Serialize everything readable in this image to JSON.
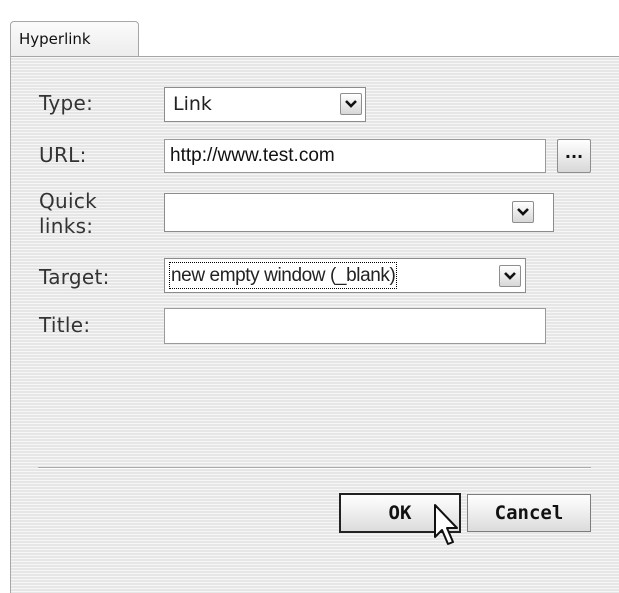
{
  "tab": {
    "label": "Hyperlink"
  },
  "fields": {
    "type": {
      "label": "Type:",
      "value": "Link"
    },
    "url": {
      "label": "URL:",
      "value": "http://www.test.com",
      "browse_label": "..."
    },
    "quick_links": {
      "label_line1": "Quick",
      "label_line2": "links:",
      "value": ""
    },
    "target": {
      "label": "Target:",
      "value": "new empty window (_blank)"
    },
    "title": {
      "label": "Title:",
      "value": ""
    }
  },
  "buttons": {
    "ok": "OK",
    "cancel": "Cancel"
  },
  "icons": {
    "dropdown": "chevron-down-icon",
    "cursor": "mouse-pointer-icon"
  }
}
